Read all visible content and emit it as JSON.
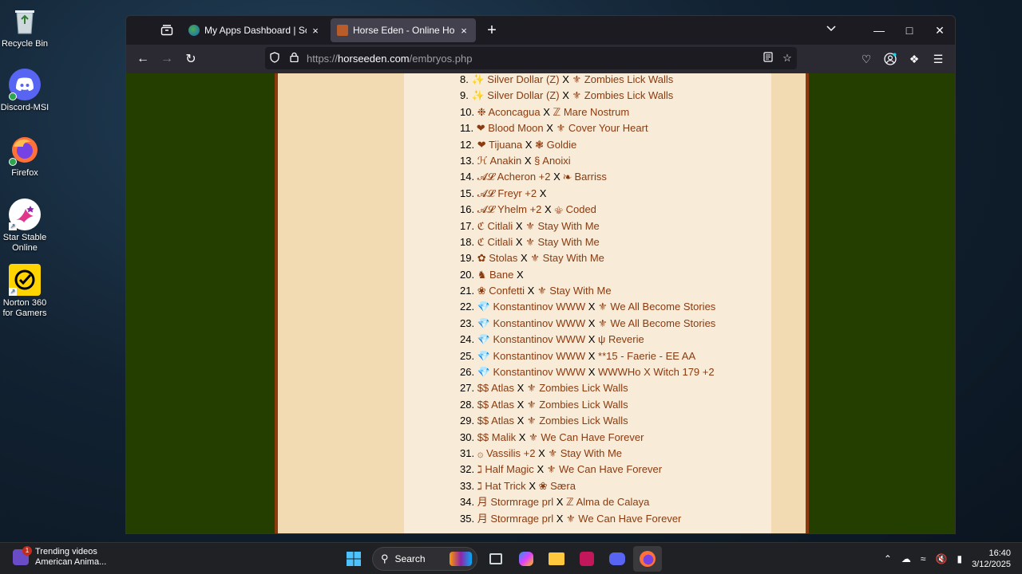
{
  "desktop": {
    "icons": [
      {
        "label": "Recycle Bin",
        "icon": "recycle-bin-icon"
      },
      {
        "label": "Discord-MSI",
        "icon": "discord-icon"
      },
      {
        "label": "Firefox",
        "icon": "firefox-icon"
      },
      {
        "label": "Star Stable Online",
        "icon": "star-stable-icon"
      },
      {
        "label": "Norton 360 for Gamers",
        "icon": "norton-icon"
      }
    ]
  },
  "browser": {
    "tabs": [
      {
        "title": "My Apps Dashboard | Southern",
        "close": "×"
      },
      {
        "title": "Horse Eden - Online Horse Gam",
        "close": "×"
      }
    ],
    "newtab": "+",
    "url_scheme": "https://",
    "url_host": "horseeden.com",
    "url_path": "/embryos.php"
  },
  "embryos": [
    {
      "num": "8.",
      "sym1": "✨",
      "name1": "Silver Dollar (Z)",
      "sep": "X",
      "sym2": "⚜",
      "name2": "Zombies Lick Walls"
    },
    {
      "num": "9.",
      "sym1": "✨",
      "name1": "Silver Dollar (Z)",
      "sep": "X",
      "sym2": "⚜",
      "name2": "Zombies Lick Walls"
    },
    {
      "num": "10.",
      "sym1": "❉",
      "name1": "Aconcagua",
      "sep": "X",
      "sym2": "ℤ",
      "name2": "Mare Nostrum"
    },
    {
      "num": "11.",
      "sym1": "❤",
      "name1": "Blood Moon",
      "sep": "X",
      "sym2": "⚜",
      "name2": "Cover Your Heart"
    },
    {
      "num": "12.",
      "sym1": "❤",
      "name1": "Tijuana",
      "sep": "X",
      "sym2": "❃",
      "name2": "Goldie"
    },
    {
      "num": "13.",
      "sym1": "ℋ",
      "name1": "Anakin",
      "sep": "X",
      "sym2": "§",
      "name2": "Anoixi"
    },
    {
      "num": "14.",
      "sym1": "𝓐𝓛",
      "name1": "Acheron +2",
      "sep": "X",
      "sym2": "❧",
      "name2": "Barriss"
    },
    {
      "num": "15.",
      "sym1": "𝓐𝓛",
      "name1": "Freyr +2",
      "sep": "X",
      "sym2": "",
      "name2": ""
    },
    {
      "num": "16.",
      "sym1": "𝓐𝓛",
      "name1": "Yhelm +2",
      "sep": "X",
      "sym2": "⚜",
      "name2": "Coded"
    },
    {
      "num": "17.",
      "sym1": "ℭ",
      "name1": "Citlali",
      "sep": "X",
      "sym2": "⚜",
      "name2": "Stay With Me"
    },
    {
      "num": "18.",
      "sym1": "ℭ",
      "name1": "Citlali",
      "sep": "X",
      "sym2": "⚜",
      "name2": "Stay With Me"
    },
    {
      "num": "19.",
      "sym1": "✿",
      "name1": "Stolas",
      "sep": "X",
      "sym2": "⚜",
      "name2": "Stay With Me"
    },
    {
      "num": "20.",
      "sym1": "♞",
      "name1": "Bane",
      "sep": "X",
      "sym2": "",
      "name2": ""
    },
    {
      "num": "21.",
      "sym1": "❀",
      "name1": "Confetti",
      "sep": "X",
      "sym2": "⚜",
      "name2": "Stay With Me"
    },
    {
      "num": "22.",
      "sym1": "💎",
      "name1": "Konstantinov WWW",
      "sep": "X",
      "sym2": "⚜",
      "name2": "We All Become Stories"
    },
    {
      "num": "23.",
      "sym1": "💎",
      "name1": "Konstantinov WWW",
      "sep": "X",
      "sym2": "⚜",
      "name2": "We All Become Stories"
    },
    {
      "num": "24.",
      "sym1": "💎",
      "name1": "Konstantinov WWW",
      "sep": "X",
      "sym2": "ψ",
      "name2": "Reverie"
    },
    {
      "num": "25.",
      "sym1": "💎",
      "name1": "Konstantinov WWW",
      "sep": "X",
      "sym2": "",
      "name2": "**15 - Faerie - EE AA"
    },
    {
      "num": "26.",
      "sym1": "💎",
      "name1": "Konstantinov WWW",
      "sep": "X",
      "sym2": "",
      "name2": "WWWHo X Witch 179 +2"
    },
    {
      "num": "27.",
      "sym1": "$$",
      "name1": "Atlas",
      "sep": "X",
      "sym2": "⚜",
      "name2": "Zombies Lick Walls"
    },
    {
      "num": "28.",
      "sym1": "$$",
      "name1": "Atlas",
      "sep": "X",
      "sym2": "⚜",
      "name2": "Zombies Lick Walls"
    },
    {
      "num": "29.",
      "sym1": "$$",
      "name1": "Atlas",
      "sep": "X",
      "sym2": "⚜",
      "name2": "Zombies Lick Walls"
    },
    {
      "num": "30.",
      "sym1": "$$",
      "name1": "Malik",
      "sep": "X",
      "sym2": "⚜",
      "name2": "We Can Have Forever"
    },
    {
      "num": "31.",
      "sym1": "۞",
      "name1": "Vassilis +2",
      "sep": "X",
      "sym2": "⚜",
      "name2": "Stay With Me"
    },
    {
      "num": "32.",
      "sym1": "ℷ",
      "name1": "Half Magic",
      "sep": "X",
      "sym2": "⚜",
      "name2": "We Can Have Forever"
    },
    {
      "num": "33.",
      "sym1": "ℷ",
      "name1": "Hat Trick",
      "sep": "X",
      "sym2": "❀",
      "name2": "Særa"
    },
    {
      "num": "34.",
      "sym1": "月",
      "name1": "Stormrage prl",
      "sep": "X",
      "sym2": "ℤ",
      "name2": "Alma de Calaya"
    },
    {
      "num": "35.",
      "sym1": "月",
      "name1": "Stormrage prl",
      "sep": "X",
      "sym2": "⚜",
      "name2": "We Can Have Forever"
    }
  ],
  "taskbar": {
    "trend_title": "Trending videos",
    "trend_sub": "American Anima...",
    "trend_badge": "1",
    "search_label": "Search",
    "time": "16:40",
    "date": "3/12/2025"
  }
}
